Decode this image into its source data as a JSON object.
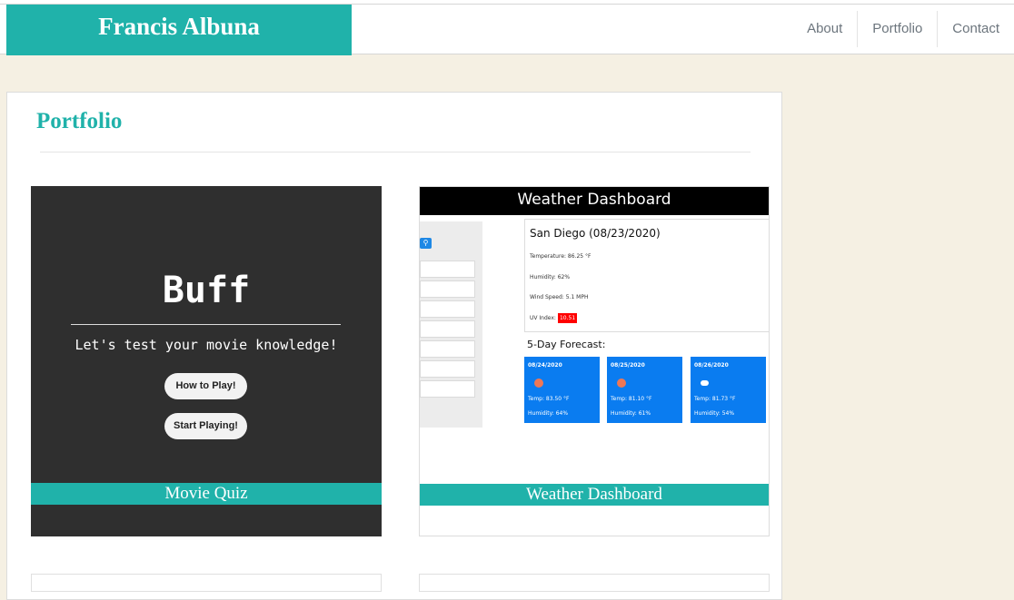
{
  "brand": {
    "name": "Francis Albuna"
  },
  "nav": {
    "items": [
      "About",
      "Portfolio",
      "Contact"
    ]
  },
  "section": {
    "title": "Portfolio"
  },
  "projects": [
    {
      "caption": "Movie Quiz",
      "preview": {
        "title": "Buff",
        "subtitle": "Let's test your movie knowledge!",
        "buttons": [
          "How to Play!",
          "Start Playing!"
        ]
      }
    },
    {
      "caption": "Weather Dashboard",
      "preview": {
        "header": "Weather Dashboard",
        "city": "San Diego (08/23/2020)",
        "temperature": "Temperature: 86.25 °F",
        "humidity": "Humidity: 62%",
        "wind": "Wind Speed: 5.1 MPH",
        "uv_label": "UV Index:",
        "uv_value": "10.51",
        "forecast_label": "5-Day Forecast:",
        "forecast": [
          {
            "date": "08/24/2020",
            "icon": "sun-icon",
            "temp": "Temp: 83.50 °F",
            "humidity": "Humidity: 64%"
          },
          {
            "date": "08/25/2020",
            "icon": "sun-icon",
            "temp": "Temp: 81.10 °F",
            "humidity": "Humidity: 61%"
          },
          {
            "date": "08/26/2020",
            "icon": "cloud-sun-icon",
            "temp": "Temp: 81.73 °F",
            "humidity": "Humidity: 54%"
          }
        ]
      }
    }
  ],
  "colors": {
    "accent": "#20b2aa",
    "page_background": "#f5f0e3",
    "dashboard_card": "#0a7cf0",
    "uv_high": "#ff0000"
  }
}
